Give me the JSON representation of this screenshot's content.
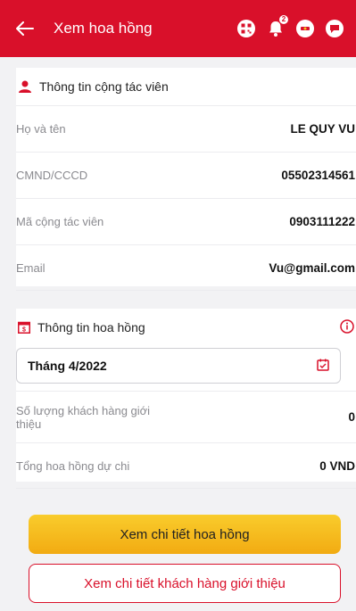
{
  "header": {
    "title": "Xem hoa hồng",
    "badge_count": "2"
  },
  "collaborator": {
    "section_title": "Thông tin cộng tác viên",
    "rows": [
      {
        "label": "Họ và tên",
        "value": "LE QUY VU"
      },
      {
        "label": "CMND/CCCD",
        "value": "05502314561"
      },
      {
        "label": "Mã cộng tác viên",
        "value": "0903111222"
      },
      {
        "label": "Email",
        "value": "Vu@gmail.com"
      }
    ]
  },
  "commission": {
    "section_title": "Thông tin hoa hồng",
    "month_value": "Tháng 4/2022",
    "rows": [
      {
        "label": "Số lượng khách hàng giới thiệu",
        "value": "0"
      },
      {
        "label": "Tổng hoa hồng dự chi",
        "value": "0 VND"
      }
    ]
  },
  "buttons": {
    "view_commission": "Xem chi tiết hoa hồng",
    "view_customers": "Xem chi tiết khách hàng giới thiệu"
  },
  "colors": {
    "brand_red": "#d9102a",
    "button_yellow": "#f5b81c"
  }
}
